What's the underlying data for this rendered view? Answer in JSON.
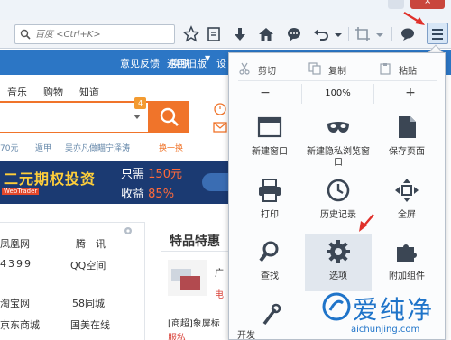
{
  "toolbar": {
    "search_placeholder": "百度 <Ctrl+K>"
  },
  "navbar": {
    "links": [
      "意见反馈",
      "返回旧版",
      "换肤",
      "设"
    ]
  },
  "page": {
    "category_tabs": [
      "音乐",
      "购物",
      "知道"
    ],
    "search_badge": "4",
    "hot_searches": [
      "70元",
      "遁甲",
      "吴亦凡做瞄宁泽涛",
      "换一换"
    ],
    "banner": {
      "headline": "二元期权投资",
      "line1_prefix": "只需",
      "line1_value": "150元",
      "line2_prefix": "收益",
      "line2_value": "85%",
      "logo": "WebTrader"
    },
    "sites": [
      [
        "凤凰网",
        "腾　讯"
      ],
      [
        "4399",
        "QQ空间"
      ],
      [
        "淘宝网",
        "58同城"
      ],
      [
        "京东商城",
        "国美在线"
      ]
    ],
    "deals": {
      "title": "特品特惠",
      "snippet1": "广",
      "snippet2": "电",
      "item1": "[商超]象屏标",
      "item2": "服私"
    }
  },
  "menu": {
    "edit": {
      "cut": "剪切",
      "copy": "复制",
      "paste": "粘贴"
    },
    "zoom": {
      "minus": "−",
      "value": "100%",
      "plus": "+"
    },
    "tiles": [
      {
        "label": "新建窗口",
        "icon": "new-window"
      },
      {
        "label": "新建隐私浏览窗口",
        "icon": "private-window-mask"
      },
      {
        "label": "保存页面",
        "icon": "save-page"
      },
      {
        "label": "打印",
        "icon": "printer"
      },
      {
        "label": "历史记录",
        "icon": "history-clock"
      },
      {
        "label": "全屏",
        "icon": "fullscreen"
      },
      {
        "label": "查找",
        "icon": "find-magnifier"
      },
      {
        "label": "选项",
        "icon": "options-gear"
      },
      {
        "label": "附加组件",
        "icon": "addons-puzzle"
      },
      {
        "label": "开发",
        "icon": "developer-wrench"
      }
    ]
  },
  "watermark": {
    "text": "爱纯净",
    "url": "aichunjing.com"
  },
  "colors": {
    "accent_blue": "#2c76c5",
    "search_orange": "#f0742a",
    "annotation_red": "#e0302a",
    "watermark_blue": "#1f74c9"
  }
}
